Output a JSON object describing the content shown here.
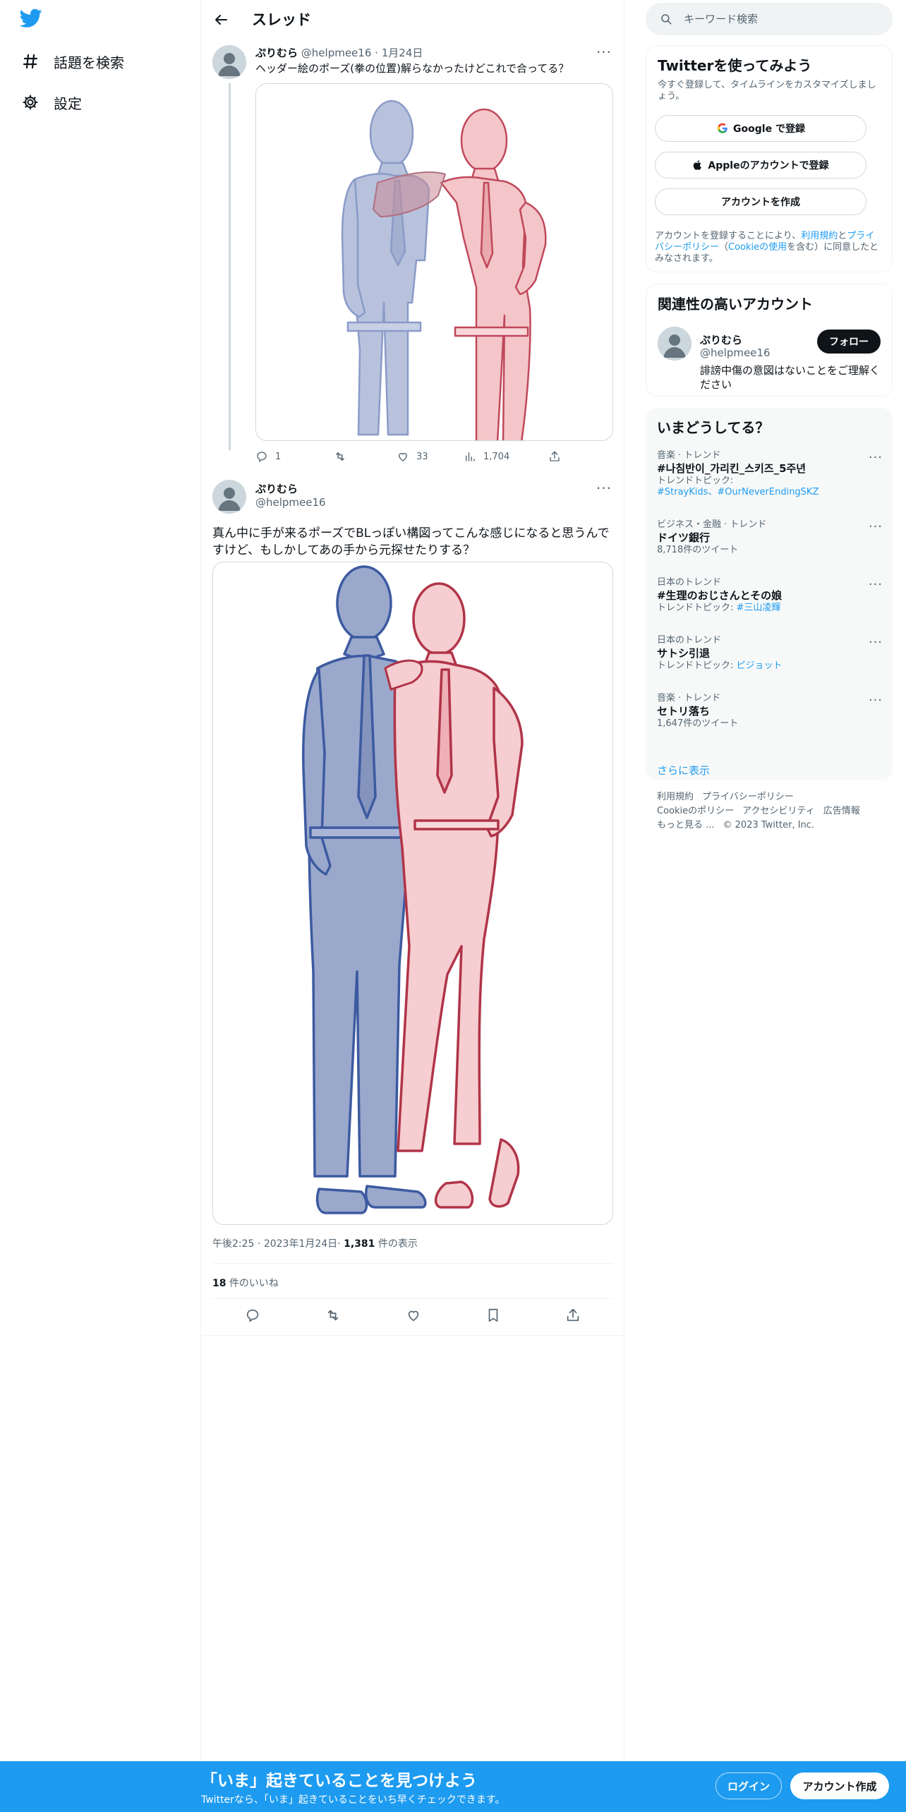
{
  "nav": {
    "logo": "twitter-bird-icon",
    "items": [
      {
        "label": "話題を検索",
        "icon": "hashtag-icon"
      },
      {
        "label": "設定",
        "icon": "gear-icon"
      }
    ]
  },
  "header": {
    "title": "スレッド"
  },
  "tweet1": {
    "name": "ぷりむら",
    "handle": "@helpmee16",
    "sep": "·",
    "date": "1月24日",
    "text": "ヘッダー絵のポーズ(拳の位置)解らなかったけどこれで合ってる？",
    "image_alt": "腰に手を当てた二人の人物の線画（青と赤）",
    "replies": "1",
    "likes": "33",
    "views": "1,704"
  },
  "tweet2": {
    "name": "ぷりむら",
    "handle": "@helpmee16",
    "text": "真ん中に手が来るポーズでBLっぽい構図ってこんな感じになると思うんですけど、もしかしてあの手から元探せたりする？",
    "image_alt": "肩に手を置いた二人の人物の線画（青と赤）",
    "time": "午後2:25",
    "sep": "·",
    "date": "2023年1月24日",
    "views": "1,381",
    "views_label": "件の表示",
    "likes": "18",
    "likes_label": "件のいいね"
  },
  "search": {
    "placeholder": "キーワード検索"
  },
  "signup_card": {
    "title": "Twitterを使ってみよう",
    "subtitle": "今すぐ登録して、タイムラインをカスタマイズしましょう。",
    "google": "Google で登録",
    "apple": "Appleのアカウントで登録",
    "create": "アカウントを作成",
    "legal_1": "アカウントを登録することにより、",
    "legal_terms": "利用規約",
    "legal_2": "と",
    "legal_privacy": "プライバシーポリシー",
    "legal_3": "（",
    "legal_cookie": "Cookieの使用",
    "legal_4": "を含む）に同意したとみなされます。"
  },
  "related": {
    "title": "関連性の高いアカウント",
    "name": "ぷりむら",
    "handle": "@helpmee16",
    "follow": "フォロー",
    "bio": "誹謗中傷の意図はないことをご理解ください"
  },
  "trends": {
    "title": "いまどうしてる？",
    "items": [
      {
        "context": "音楽 · トレンド",
        "title": "#나침반이_가리킨_스키즈_5주년",
        "sub_label": "トレンドトピック: ",
        "sub_links": "#StrayKids、#OurNeverEndingSKZ"
      },
      {
        "context": "ビジネス・金融 · トレンド",
        "title": "ドイツ銀行",
        "sub": "8,718件のツイート"
      },
      {
        "context": "日本のトレンド",
        "title": "#生理のおじさんとその娘",
        "sub_label": "トレンドトピック: ",
        "sub_links": "#三山凌輝"
      },
      {
        "context": "日本のトレンド",
        "title": "サトシ引退",
        "sub_label": "トレンドトピック: ",
        "sub_links": "ピジョット"
      },
      {
        "context": "音楽 · トレンド",
        "title": "セトリ落ち",
        "sub": "1,647件のツイート"
      }
    ],
    "show_more": "さらに表示"
  },
  "footer": {
    "terms": "利用規約",
    "privacy": "プライバシーポリシー",
    "cookie": "Cookieのポリシー",
    "accessibility": "アクセシビリティ",
    "ads": "広告情報",
    "more": "もっと見る ...",
    "copyright": "© 2023 Twitter, Inc."
  },
  "bottom_bar": {
    "title": "「いま」起きていることを見つけよう",
    "subtitle": "Twitterなら、「いま」起きていることをいち早くチェックできます。",
    "login": "ログイン",
    "signup": "アカウント作成"
  },
  "colors": {
    "accent": "#1d9bf0",
    "text": "#0f1419",
    "muted": "#536471",
    "figure_blue": "#5570b0",
    "figure_red": "#c0485a"
  }
}
